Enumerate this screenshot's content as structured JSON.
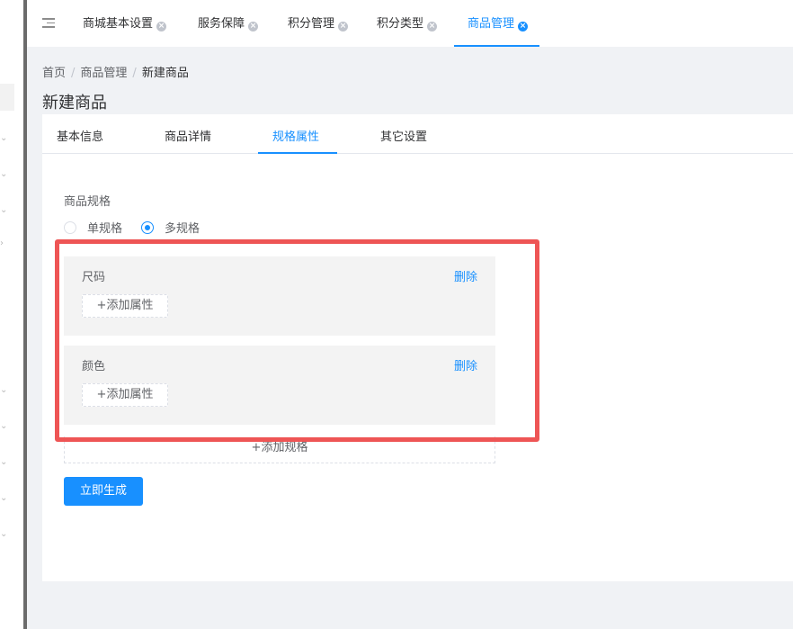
{
  "top_tabs": [
    {
      "label": "商城基本设置",
      "active": false
    },
    {
      "label": "服务保障",
      "active": false
    },
    {
      "label": "积分管理",
      "active": false
    },
    {
      "label": "积分类型",
      "active": false
    },
    {
      "label": "商品管理",
      "active": true
    }
  ],
  "breadcrumb": {
    "home": "首页",
    "parent": "商品管理",
    "current": "新建商品",
    "separator": "/"
  },
  "page_title": "新建商品",
  "sub_tabs": [
    {
      "label": "基本信息",
      "active": false
    },
    {
      "label": "商品详情",
      "active": false
    },
    {
      "label": "规格属性",
      "active": true
    },
    {
      "label": "其它设置",
      "active": false
    }
  ],
  "spec_section": {
    "label": "商品规格",
    "options": [
      {
        "label": "单规格",
        "checked": false
      },
      {
        "label": "多规格",
        "checked": true
      }
    ],
    "groups": [
      {
        "name": "尺码",
        "delete_label": "删除",
        "add_attr_label": "+添加属性"
      },
      {
        "name": "颜色",
        "delete_label": "删除",
        "add_attr_label": "+添加属性"
      }
    ],
    "add_spec_label": "+添加规格",
    "generate_label": "立即生成"
  },
  "colors": {
    "accent": "#1890ff",
    "highlight": "#ee5555",
    "group_bg": "#f3f3f3"
  },
  "icons": {
    "menu": "menu-fold-icon",
    "tab_close": "close-circle-icon",
    "sidebar_chevron": "chevron-down-icon"
  }
}
